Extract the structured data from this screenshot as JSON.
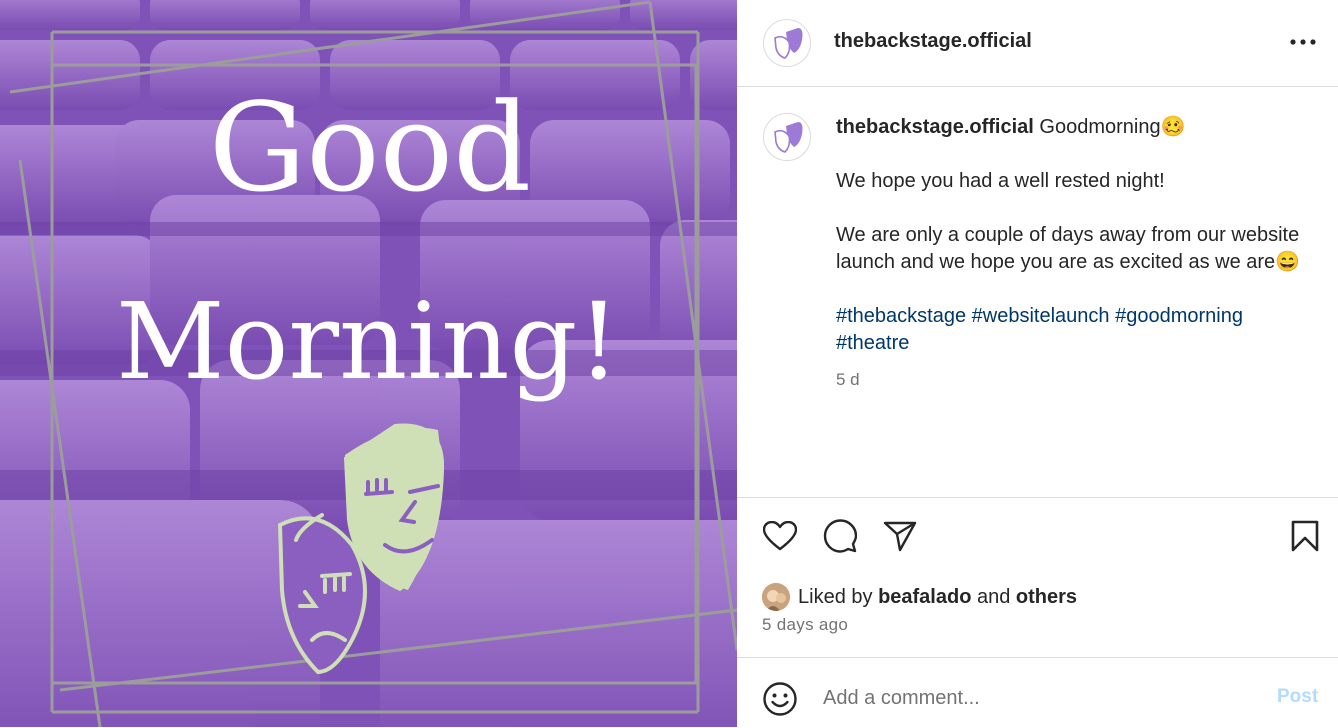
{
  "post": {
    "image": {
      "line1": "Good",
      "line2": "Morning!",
      "background_color": "#8a5fc0",
      "text_color": "#ffffff",
      "mask_color": "#cfe0b6",
      "frame_color": "#9c9c9c"
    },
    "account": {
      "username": "thebackstage.official",
      "avatar_icon": "theatre-masks-icon",
      "more_icon": "more-options-icon"
    },
    "caption": {
      "username": "thebackstage.official",
      "first_line": "Goodmorning🥴",
      "line2": "We hope you had a well rested night!",
      "line3": "We are only a couple of days away from our website launch and we hope you are as excited as we are😄",
      "hashtags": [
        "#thebackstage",
        "#websitelaunch",
        "#goodmorning",
        "#theatre"
      ],
      "age": "5 d"
    },
    "actions": {
      "like_icon": "heart-icon",
      "comment_icon": "comment-icon",
      "share_icon": "share-icon",
      "save_icon": "bookmark-icon"
    },
    "likes": {
      "prefix": "Liked by",
      "user": "beafalado",
      "connector": "and",
      "others": "others"
    },
    "timestamp": "5 days ago",
    "comment_box": {
      "placeholder": "Add a comment...",
      "post_label": "Post",
      "emoji_icon": "emoji-icon"
    }
  }
}
